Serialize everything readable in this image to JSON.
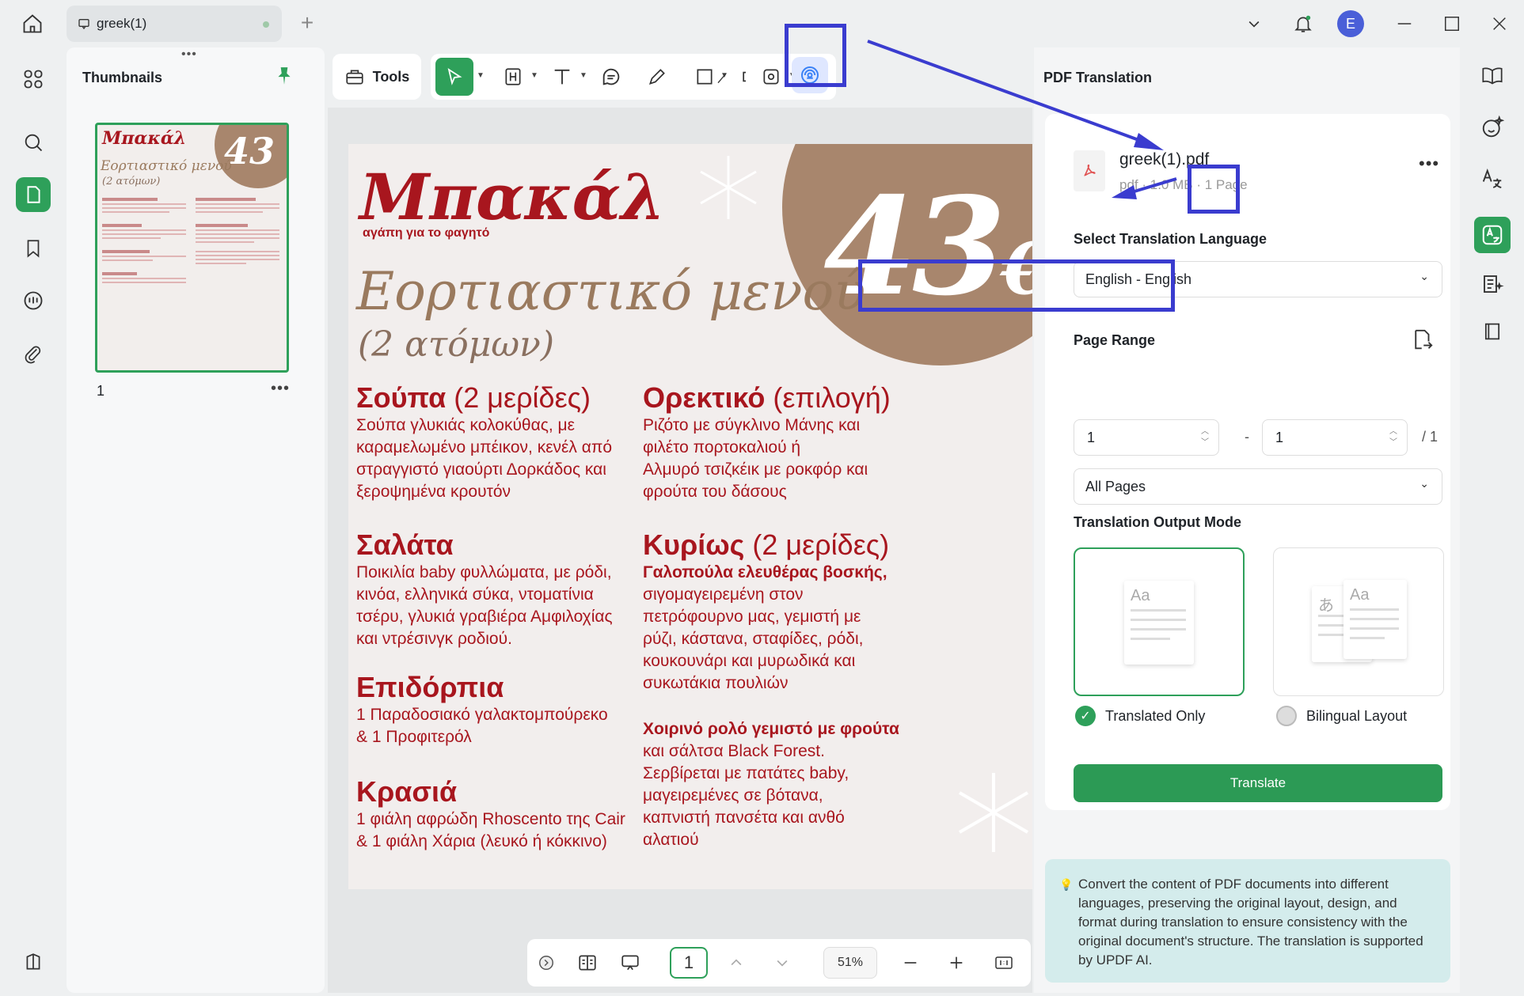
{
  "tab": {
    "title": "greek(1)"
  },
  "leftpanel": {
    "title": "Thumbnails",
    "page_number": "1"
  },
  "toolbar": {
    "tools_label": "Tools"
  },
  "pdf": {
    "brand": "Μπακάλ",
    "brand_sub": "αγάπη για το φαγητό",
    "heading": "Εορτιαστικό μενού",
    "persons": "(2 ατόμων)",
    "price": "43",
    "price_symbol": "€",
    "sections": [
      {
        "title": "Σούπα",
        "note": "(2 μερίδες)",
        "lines": [
          "Σούπα γλυκιάς κολοκύθας, με",
          "καραμελωμένο μπέικον, κενέλ από",
          "στραγγιστό γιαούρτι Δορκάδος και",
          "ξεροψημένα κρουτόν"
        ]
      },
      {
        "title": "Ορεκτικό",
        "note": "(επιλογή)",
        "lines": [
          "Ριζότο με σύγκλινο Μάνης και",
          "φιλέτο πορτοκαλιού ή",
          "Αλμυρό τσιζκέικ με ροκφόρ και",
          "φρούτα του δάσους"
        ]
      },
      {
        "title": "Σαλάτα",
        "note": "",
        "lines": [
          "Ποικιλία baby φυλλώματα, με ρόδι,",
          "κινόα, ελληνικά σύκα, ντοματίνια",
          "τσέρυ, γλυκιά γραβιέρα Αμφιλοχίας",
          "και ντρέσινγκ ροδιού."
        ]
      },
      {
        "title": "Κυρίως",
        "note": "(2 μερίδες)",
        "lines": [
          "Γαλοπούλα ελευθέρας βοσκής,",
          "σιγομαγειρεμένη στον",
          "πετρόφουρνο μας, γεμιστή με",
          "ρύζι, κάστανα, σταφίδες, ρόδι,",
          "κουκουνάρι και μυρωδικά και",
          "συκωτάκια πουλιών"
        ]
      },
      {
        "title": "Επιδόρπια",
        "note": "",
        "lines": [
          "1 Παραδοσιακό γαλακτομπούρεκο",
          "& 1 Προφιτερόλ"
        ]
      },
      {
        "title": "",
        "note": "",
        "lines": [
          "Χοιρινό ρολό γεμιστό με φρούτα",
          "και σάλτσα Black Forest.",
          "Σερβίρεται με πατάτες baby,",
          "μαγειρεμένες σε βότανα,",
          "καπνιστή πανσέτα και ανθό",
          "αλατιού"
        ]
      },
      {
        "title": "Κρασιά",
        "note": "",
        "lines": [
          "1 φιάλη αφρώδη Rhoscento της Cair",
          "& 1 φιάλη Χάρια (λευκό ή κόκκινο)"
        ]
      }
    ]
  },
  "bottombar": {
    "page": "1",
    "zoom": "51%"
  },
  "translation": {
    "panel_title": "PDF Translation",
    "file_name": "greek(1).pdf",
    "file_meta": "pdf · 1.0 MB · 1 Page",
    "language_label": "Select Translation Language",
    "language_value": "English - English",
    "page_range_label": "Page Range",
    "range_from": "1",
    "range_dash": "-",
    "range_to": "1",
    "range_total": "/ 1",
    "pages_option": "All Pages",
    "output_mode_label": "Translation Output Mode",
    "mode_translated": "Translated Only",
    "mode_bilingual": "Bilingual Layout",
    "mode_glyph_latin": "Aa",
    "mode_glyph_cjk": "あ",
    "translate_button": "Translate",
    "info": "Convert the content of PDF documents into different languages, preserving the original layout, design, and format during translation to ensure consistency with the original document's structure. The translation is supported by UPDF AI."
  },
  "colors": {
    "accent_green": "#2ea05a",
    "highlight_blue": "#3a3ccf",
    "menu_red": "#a8161e",
    "avatar_blue": "#4a5fd8"
  },
  "user": {
    "avatar_initial": "E"
  }
}
